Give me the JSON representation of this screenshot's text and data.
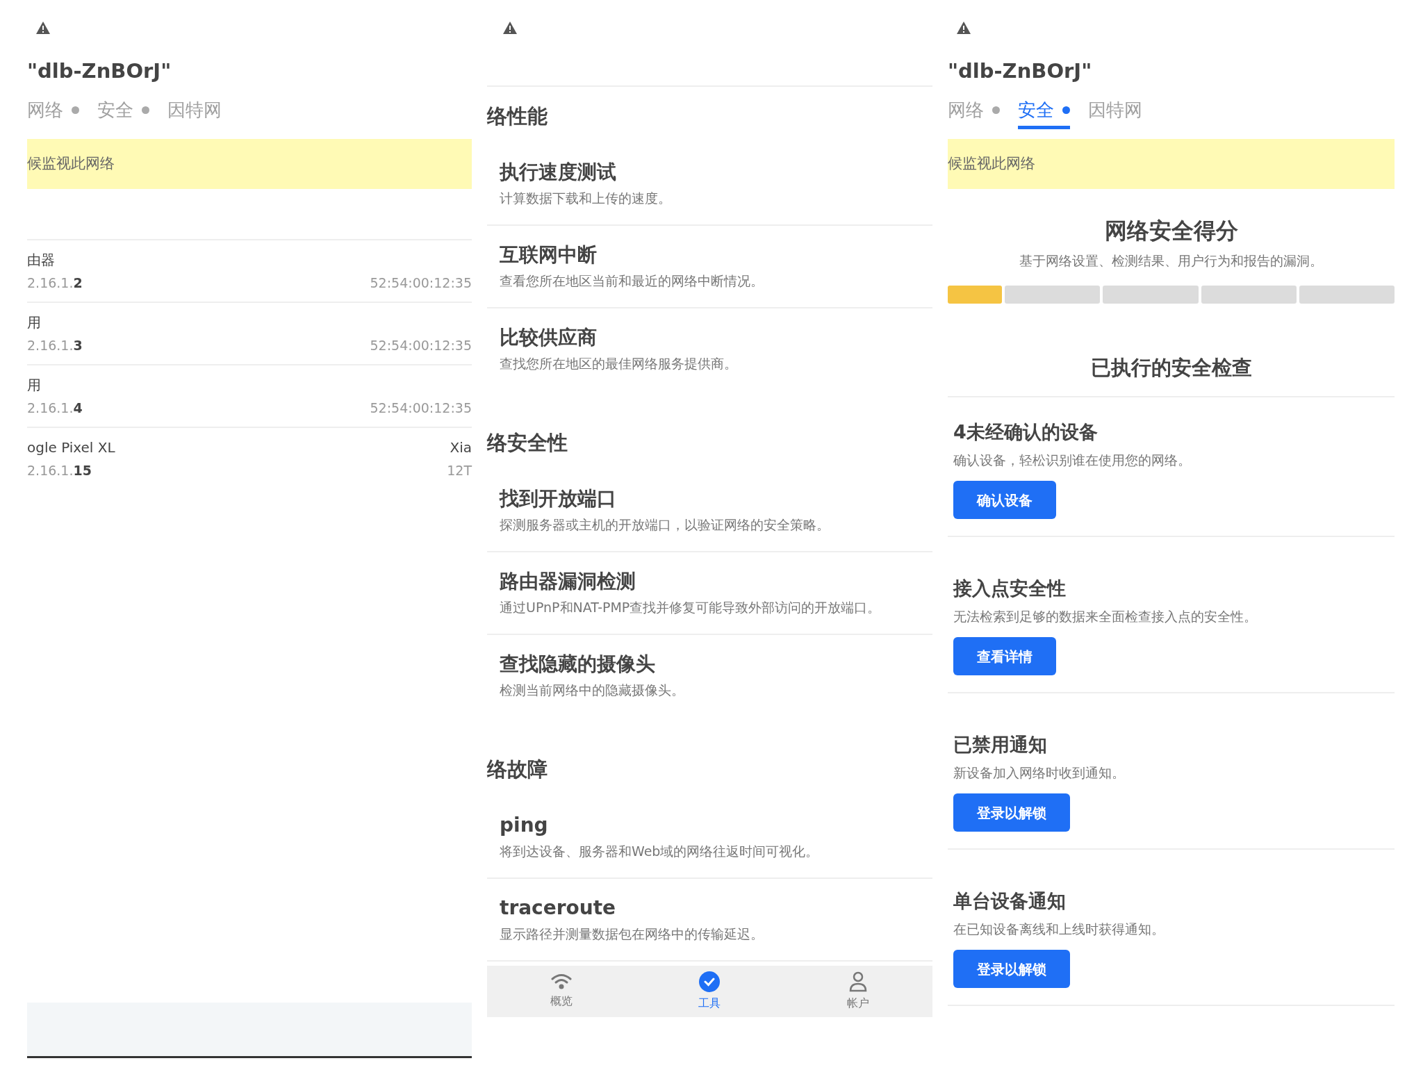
{
  "panels": [
    {
      "kind": "devices",
      "network_name": "\"dlb-ZnBOrJ\"",
      "tabs": [
        {
          "label": "网络",
          "dot": true,
          "selected": false
        },
        {
          "label": "安全",
          "dot": true,
          "selected": false
        },
        {
          "label": "因特网",
          "dot": false,
          "selected": false
        }
      ],
      "banner": "候监视此网络",
      "devices": [
        {
          "name": "由器",
          "ip": "2.16.1.**2**",
          "mac": "52:54:00:12:35"
        },
        {
          "name": "用",
          "ip": "2.16.1.**3**",
          "mac": "52:54:00:12:35"
        },
        {
          "name": "用",
          "ip": "2.16.1.**4**",
          "mac": "52:54:00:12:35"
        },
        {
          "name": "ogle Pixel XL",
          "ip": "2.16.1.**15**",
          "vendor": "Xia",
          "mac": "12T"
        }
      ]
    },
    {
      "kind": "tools",
      "sections": [
        {
          "title": "络性能",
          "items": [
            {
              "title": "执行速度测试",
              "desc": "计算数据下载和上传的速度。"
            },
            {
              "title": "互联网中断",
              "desc": "查看您所在地区当前和最近的网络中断情况。"
            },
            {
              "title": "比较供应商",
              "desc": "查找您所在地区的最佳网络服务提供商。"
            }
          ]
        },
        {
          "title": "络安全性",
          "items": [
            {
              "title": "找到开放端口",
              "desc": "探测服务器或主机的开放端口，以验证网络的安全策略。"
            },
            {
              "title": "路由器漏洞检测",
              "desc": "通过UPnP和NAT-PMP查找并修复可能导致外部访问的开放端口。"
            },
            {
              "title": "查找隐藏的摄像头",
              "desc": "检测当前网络中的隐藏摄像头。"
            }
          ]
        },
        {
          "title": "络故障",
          "items": [
            {
              "title": "ping",
              "desc": "将到达设备、服务器和Web域的网络往返时间可视化。"
            },
            {
              "title": "traceroute",
              "desc": "显示路径并测量数据包在网络中的传输延迟。"
            }
          ]
        }
      ],
      "nav": [
        {
          "label": "概览",
          "selected": false
        },
        {
          "label": "工具",
          "selected": true
        },
        {
          "label": "帐户",
          "selected": false
        }
      ]
    },
    {
      "kind": "security",
      "network_name": "\"dlb-ZnBOrJ\"",
      "tabs": [
        {
          "label": "网络",
          "dot": true,
          "selected": false
        },
        {
          "label": "安全",
          "dot": true,
          "selected": true
        },
        {
          "label": "因特网",
          "dot": false,
          "selected": false
        }
      ],
      "banner": "候监视此网络",
      "score": {
        "title": "网络安全得分",
        "subtitle": "基于网络设置、检测结果、用户行为和报告的漏洞。",
        "segments": [
          {
            "filled": true
          },
          {
            "filled": false
          },
          {
            "filled": false
          },
          {
            "filled": false
          },
          {
            "filled": false
          }
        ]
      },
      "checks_title": "已执行的安全检查",
      "checks": [
        {
          "title": "4未经确认的设备",
          "desc": "确认设备，轻松识别谁在使用您的网络。",
          "button": "确认设备"
        },
        {
          "title": "接入点安全性",
          "desc": "无法检索到足够的数据来全面检查接入点的安全性。",
          "button": "查看详情"
        },
        {
          "title": "已禁用通知",
          "desc": "新设备加入网络时收到通知。",
          "button": "登录以解锁"
        },
        {
          "title": "单台设备通知",
          "desc": "在已知设备离线和上线时获得通知。",
          "button": "登录以解锁"
        }
      ]
    }
  ]
}
